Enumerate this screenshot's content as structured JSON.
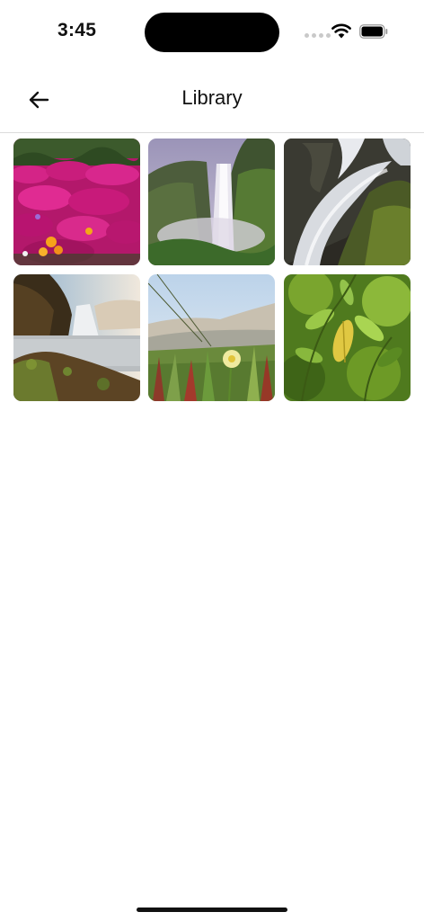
{
  "status_bar": {
    "time": "3:45",
    "wifi_icon": "wifi-icon",
    "battery_icon": "battery-full-icon"
  },
  "nav": {
    "back_icon": "arrow-left-icon",
    "title": "Library"
  },
  "gallery": {
    "items": [
      {
        "subject": "flower-field-photo"
      },
      {
        "subject": "waterfall-cliff-photo"
      },
      {
        "subject": "cascade-rocks-photo"
      },
      {
        "subject": "waterfall-shore-photo"
      },
      {
        "subject": "dune-grass-flower-photo"
      },
      {
        "subject": "green-leaves-photo"
      }
    ]
  }
}
